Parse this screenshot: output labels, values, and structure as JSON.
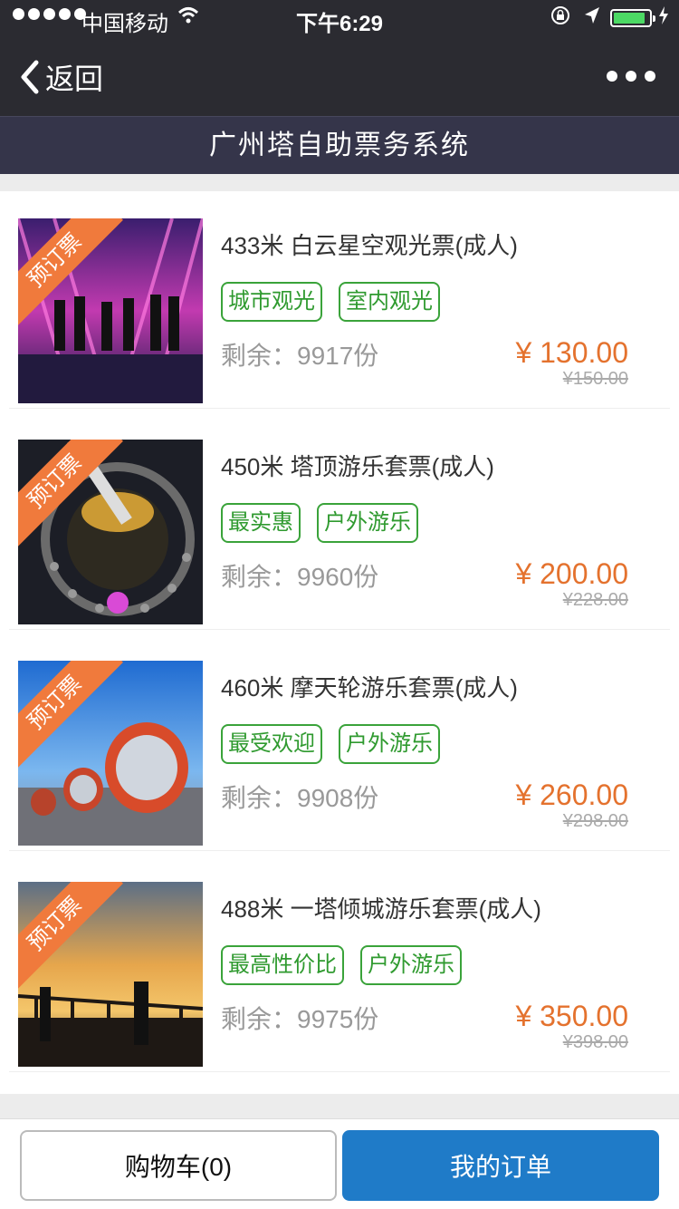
{
  "status": {
    "carrier": "中国移动",
    "time": "下午6:29"
  },
  "nav": {
    "back_label": "返回"
  },
  "title": "广州塔自助票务系统",
  "ribbon_label": "预订票",
  "tickets": [
    {
      "name": "433米 白云星空观光票(成人)",
      "tags": [
        "城市观光",
        "室内观光"
      ],
      "remain": "剩余：9917份",
      "price": "¥ 130.00",
      "old_price": "¥150.00"
    },
    {
      "name": "450米 塔顶游乐套票(成人)",
      "tags": [
        "最实惠",
        "户外游乐"
      ],
      "remain": "剩余：9960份",
      "price": "¥ 200.00",
      "old_price": "¥228.00"
    },
    {
      "name": "460米 摩天轮游乐套票(成人)",
      "tags": [
        "最受欢迎",
        "户外游乐"
      ],
      "remain": "剩余：9908份",
      "price": "¥ 260.00",
      "old_price": "¥298.00"
    },
    {
      "name": "488米 一塔倾城游乐套票(成人)",
      "tags": [
        "最高性价比",
        "户外游乐"
      ],
      "remain": "剩余：9975份",
      "price": "¥ 350.00",
      "old_price": "¥398.00"
    }
  ],
  "bottom": {
    "cart_label": "购物车(0)",
    "orders_label": "我的订单"
  },
  "colors": {
    "accent_price": "#e4722e",
    "tag_green": "#3aa33a",
    "primary_button": "#1f7bc8",
    "ribbon": "#f07a3c"
  }
}
